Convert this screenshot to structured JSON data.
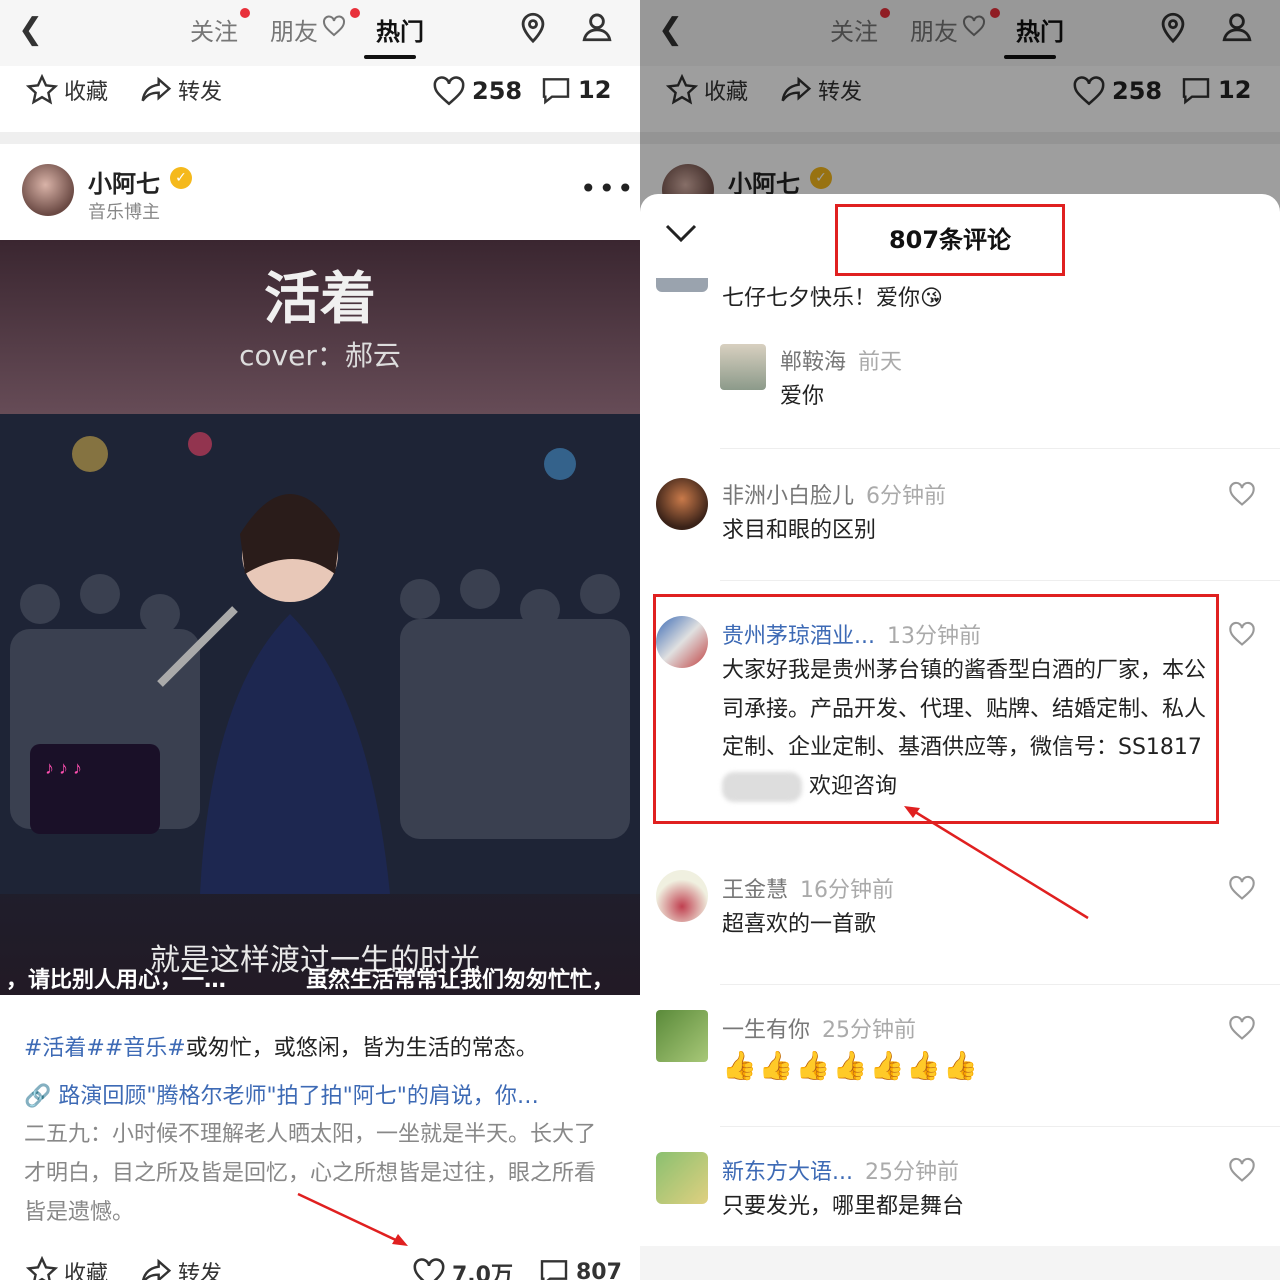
{
  "nav": {
    "tabs": [
      "关注",
      "朋友",
      "热门"
    ],
    "active_tab": "热门"
  },
  "action_bar": {
    "collect_label": "收藏",
    "share_label": "转发",
    "likes": "258",
    "comments": "12"
  },
  "post": {
    "author_name": "小阿七",
    "author_role": "音乐博主",
    "video": {
      "title": "活着",
      "cover_line": "cover：郝云",
      "subtitle_top": "就是这样渡过一生的时光",
      "subtitle_left": "，请比别人用心，一…",
      "subtitle_right": "虽然生活常常让我们匆匆忙忙，"
    },
    "caption_tags": "#活着##音乐#",
    "caption_rest": "或匆忙，或悠闲，皆为生活的常态。",
    "link_text": "路演回顾\"腾格尔老师\"拍了拍\"阿七\"的肩说，你…",
    "body_text": "二五九：小时候不理解老人晒太阳，一坐就是半天。长大了才明白，目之所及皆是回忆，心之所想皆是过往，眼之所看皆是遗憾。",
    "bottom_collect": "收藏",
    "bottom_share": "转发",
    "bottom_likes": "7.0万",
    "bottom_comments": "807"
  },
  "comments_sheet": {
    "title": "807条评论",
    "comments": [
      {
        "text": "七仔七夕快乐！爱你😘"
      },
      {
        "name": "郸鞍海",
        "time": "前天",
        "text": "爱你"
      },
      {
        "name": "非洲小白脸儿",
        "time": "6分钟前",
        "text": "求目和眼的区别"
      },
      {
        "name": "贵州茅琼酒业...",
        "time": "13分钟前",
        "text": "大家好我是贵州茅台镇的酱香型白酒的厂家，本公司承接。产品开发、代理、贴牌、结婚定制、私人定制、企业定制、基酒供应等，微信号：SS1817",
        "text_after_blur": "欢迎咨询"
      },
      {
        "name": "王金慧",
        "time": "16分钟前",
        "text": "超喜欢的一首歌"
      },
      {
        "name": "一生有你",
        "time": "25分钟前",
        "text": "👍👍👍👍👍👍👍"
      },
      {
        "name": "新东方大语...",
        "time": "25分钟前",
        "text": "只要发光，哪里都是舞台"
      }
    ]
  },
  "colors": {
    "accent_red": "#e02020",
    "link_blue": "#3d6ab5",
    "verified_gold": "#f5b91c"
  }
}
